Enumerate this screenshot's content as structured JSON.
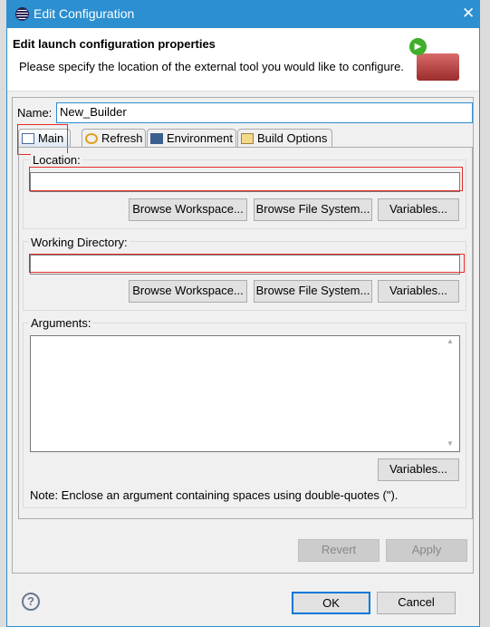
{
  "window": {
    "title": "Edit Configuration",
    "close": "✕"
  },
  "header": {
    "title": "Edit launch configuration properties",
    "description": "Please specify the location of the external tool you would like to configure."
  },
  "name": {
    "label": "Name:",
    "value": "New_Builder"
  },
  "tabs": [
    {
      "label": "Main",
      "icon": "main-tab-icon",
      "selected": true
    },
    {
      "label": "Refresh",
      "icon": "refresh-icon"
    },
    {
      "label": "Environment",
      "icon": "environment-icon"
    },
    {
      "label": "Build Options",
      "icon": "folder-icon"
    }
  ],
  "location": {
    "label": "Location:",
    "value": "",
    "browse_workspace": "Browse Workspace...",
    "browse_fs": "Browse File System...",
    "variables": "Variables..."
  },
  "working_directory": {
    "label": "Working Directory:",
    "value": "",
    "browse_workspace": "Browse Workspace...",
    "browse_fs": "Browse File System...",
    "variables": "Variables..."
  },
  "arguments": {
    "label": "Arguments:",
    "value": "",
    "variables": "Variables...",
    "note": "Note: Enclose an argument containing spaces using double-quotes (\")."
  },
  "actions": {
    "revert": "Revert",
    "apply": "Apply",
    "ok": "OK",
    "cancel": "Cancel"
  },
  "colors": {
    "titlebar": "#2b8fd0",
    "highlight": "#e82a2a"
  }
}
